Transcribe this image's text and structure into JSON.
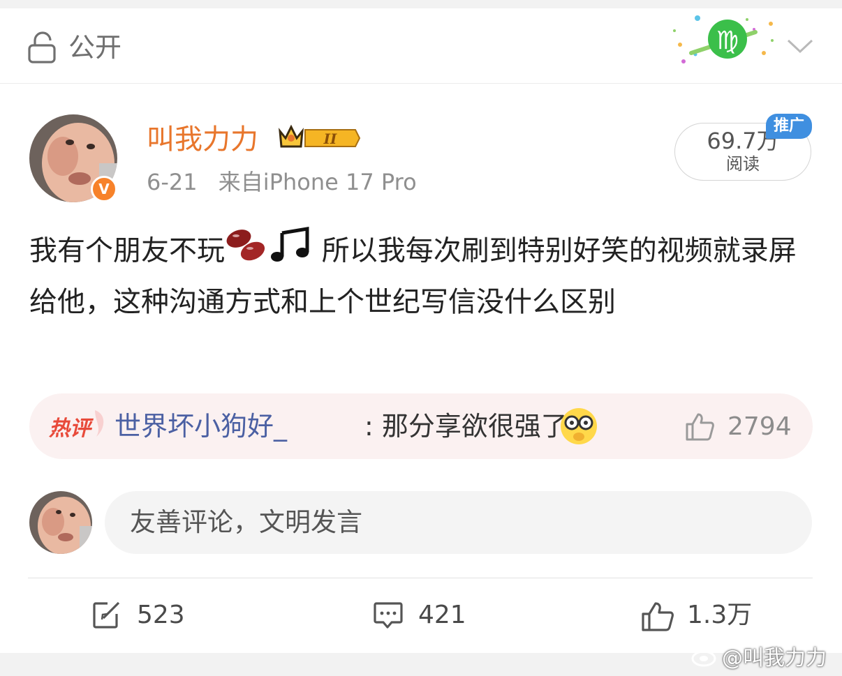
{
  "privacy": {
    "label": "公开",
    "icon": "lock-open-icon"
  },
  "header_sticker": {
    "icon": "virgo-sticker-icon",
    "accent": "#3bbf4a"
  },
  "post": {
    "author": "叫我力力",
    "member_badge": {
      "level_text": "II",
      "icon": "crown-icon"
    },
    "verified_icon": "verified-v-icon",
    "date": "6-21",
    "source": "来自iPhone 17 Pro",
    "reads": {
      "value": "69.7万",
      "label": "阅读"
    },
    "promo_tag": "推广",
    "text_part1": "我有个朋友不玩",
    "text_part2": " 所以我每次刷到特别好笑的视频就录屏给他，这种沟通方式和上个世纪写信没什么区别",
    "emojis": [
      "beans-icon",
      "music-note-icon"
    ]
  },
  "hot_comment": {
    "tag": "热评",
    "user": "世界坏小狗好_",
    "text": ": 那分享欲很强了",
    "emoji": "glasses-face-icon",
    "likes": "2794"
  },
  "comment_input": {
    "placeholder": "友善评论，文明发言"
  },
  "actions": {
    "repost": "523",
    "comment": "421",
    "like": "1.3万"
  },
  "watermark": "@叫我力力",
  "colors": {
    "username": "#e8762c",
    "link_user": "#4b60a3",
    "promo": "#3f8fe0",
    "hot_bg": "#fbf1f1",
    "verified": "#f7822a"
  }
}
